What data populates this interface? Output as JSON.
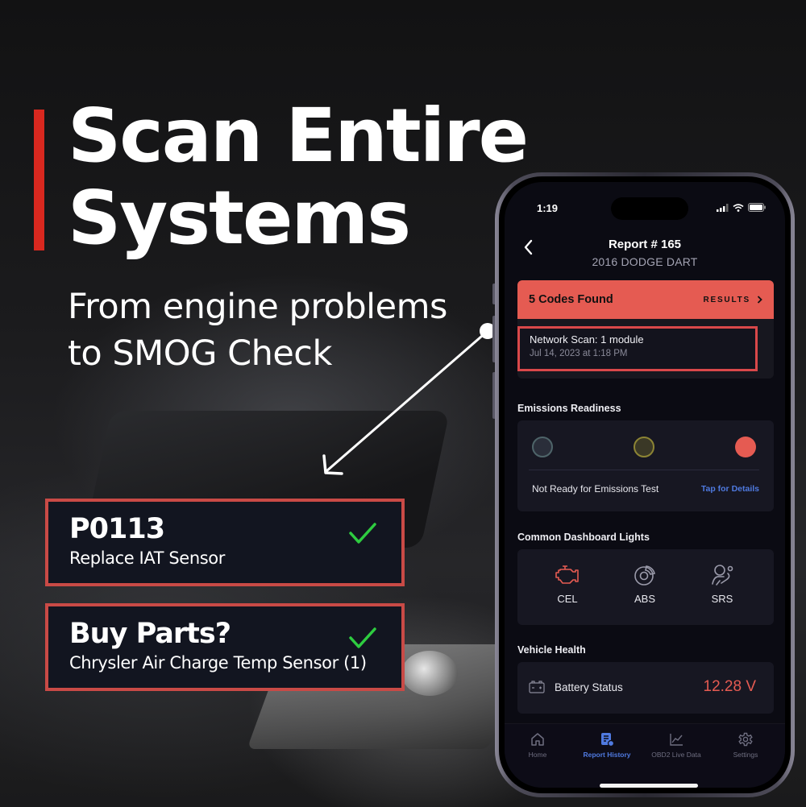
{
  "marketing": {
    "headline_line1": "Scan Entire",
    "headline_line2": "Systems",
    "subhead_line1": "From engine problems",
    "subhead_line2": "to SMOG Check",
    "accent_color": "#d9281f"
  },
  "callouts": [
    {
      "title": "P0113",
      "subtitle": "Replace IAT Sensor",
      "icon": "check-icon",
      "check_color": "#2ecc40"
    },
    {
      "title": "Buy Parts?",
      "subtitle": "Chrysler Air Charge Temp Sensor (1)",
      "icon": "check-icon",
      "check_color": "#2ecc40"
    }
  ],
  "phone": {
    "status_bar": {
      "time": "1:19",
      "icons": [
        "cellular-signal-icon",
        "wifi-icon",
        "battery-icon"
      ]
    },
    "nav": {
      "back_icon": "chevron-left-icon",
      "title": "Report # 165",
      "subtitle": "2016 DODGE DART"
    },
    "codes": {
      "title": "5 Codes Found",
      "results_label": "RESULTS",
      "results_icon": "chevron-right-icon",
      "banner_color": "#e55b52",
      "scan_title": "Network Scan: 1 module",
      "scan_date": "Jul 14, 2023 at 1:18 PM"
    },
    "emissions": {
      "section_title": "Emissions Readiness",
      "indicators": [
        {
          "name": "indicator-gray",
          "color": "#4e6469"
        },
        {
          "name": "indicator-yellow",
          "color": "#8c8434"
        },
        {
          "name": "indicator-red",
          "color": "#e55b52"
        }
      ],
      "status_text": "Not Ready for Emissions Test",
      "details_link": "Tap for Details"
    },
    "dashboard_lights": {
      "section_title": "Common Dashboard Lights",
      "items": [
        {
          "label": "CEL",
          "icon": "check-engine-icon",
          "color": "#e55b52"
        },
        {
          "label": "ABS",
          "icon": "brake-disc-icon",
          "color": "#9a9aaa"
        },
        {
          "label": "SRS",
          "icon": "airbag-icon",
          "color": "#9a9aaa"
        }
      ]
    },
    "vehicle_health": {
      "section_title": "Vehicle Health",
      "battery_label": "Battery Status",
      "battery_value": "12.28 V",
      "battery_icon": "car-battery-icon"
    },
    "tabbar": {
      "active": "Report History",
      "tabs": [
        {
          "label": "Home",
          "icon": "home-icon"
        },
        {
          "label": "Report History",
          "icon": "report-history-icon"
        },
        {
          "label": "OBD2 Live Data",
          "icon": "line-chart-icon"
        },
        {
          "label": "Settings",
          "icon": "gear-icon"
        }
      ]
    }
  }
}
